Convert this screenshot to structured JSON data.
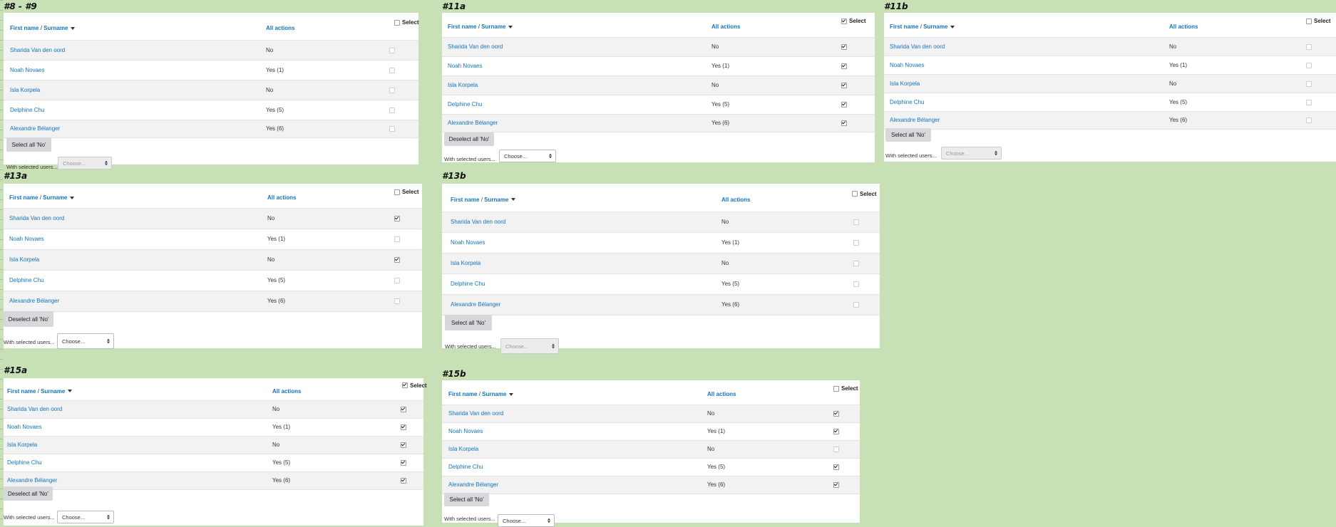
{
  "common": {
    "col_first": "First name",
    "col_sep": " / ",
    "col_surname": "Surname",
    "col_actions": "All actions",
    "col_select": "Select",
    "with_selected": "With selected users...",
    "choose": "Choose...",
    "users": [
      {
        "name": "Sharida Van den oord",
        "actions": "No"
      },
      {
        "name": "Noah Novaes",
        "actions": "Yes (1)"
      },
      {
        "name": "Isla Korpela",
        "actions": "No"
      },
      {
        "name": "Delphine Chu",
        "actions": "Yes (5)"
      },
      {
        "name": "Alexandre Bélanger",
        "actions": "Yes (6)"
      }
    ]
  },
  "variants": [
    {
      "id": "v8",
      "label": "#8 - #9",
      "button": "Select all 'No'",
      "header_checked": false,
      "checked": [
        false,
        false,
        false,
        false,
        false
      ],
      "choose_disabled": true
    },
    {
      "id": "v11a",
      "label": "#11a",
      "button": "Deselect all 'No'",
      "header_checked": true,
      "checked": [
        true,
        true,
        true,
        true,
        true
      ],
      "choose_disabled": false
    },
    {
      "id": "v11b",
      "label": "#11b",
      "button": "Select all 'No'",
      "header_checked": false,
      "checked": [
        false,
        false,
        false,
        false,
        false
      ],
      "choose_disabled": true
    },
    {
      "id": "v13a",
      "label": "#13a",
      "button": "Deselect all 'No'",
      "header_checked": false,
      "checked": [
        true,
        false,
        true,
        false,
        false
      ],
      "choose_disabled": false
    },
    {
      "id": "v13b",
      "label": "#13b",
      "button": "Select all 'No'",
      "header_checked": false,
      "checked": [
        false,
        false,
        false,
        false,
        false
      ],
      "choose_disabled": true
    },
    {
      "id": "v15a",
      "label": "#15a",
      "button": "Deselect all 'No'",
      "header_checked": true,
      "checked": [
        true,
        true,
        true,
        true,
        true
      ],
      "choose_disabled": false
    },
    {
      "id": "v15b",
      "label": "#15b",
      "button": "Select all 'No'",
      "header_checked": false,
      "checked": [
        true,
        true,
        false,
        true,
        true
      ],
      "choose_disabled": false
    }
  ]
}
